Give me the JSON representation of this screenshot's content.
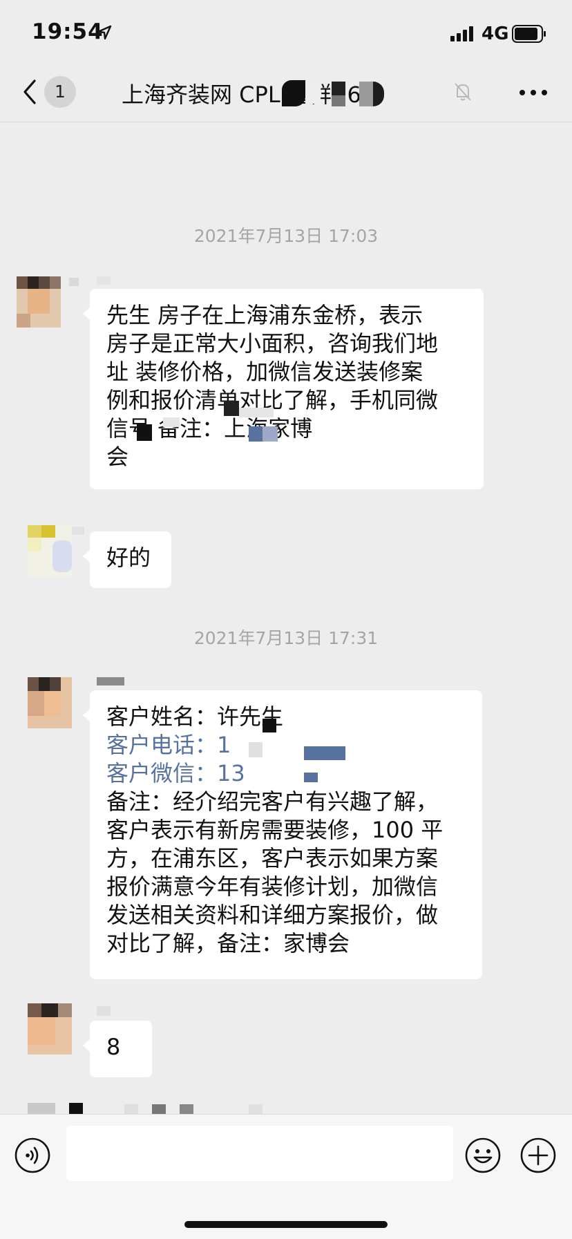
{
  "status_bar": {
    "time": "19:54",
    "network": "4G"
  },
  "nav": {
    "unread_count": "1",
    "title": "上海齐装网 CPL      通群 (6)"
  },
  "colors": {
    "background": "#ededed",
    "bubble": "#ffffff",
    "timestamp": "#a5a5a5",
    "link_blue": "#5872a0"
  },
  "messages": [
    {
      "type": "timestamp",
      "text": "2021年7月13日 17:03"
    },
    {
      "type": "text",
      "lines": [
        "先生 房子在上海浦东金桥，表示",
        "房子是正常大小面积，咨询我们地",
        "址 装修价格，加微信发送装修案",
        "例和报价清单对比了解，手机同微",
        "信号            备注：上海家博",
        "会"
      ]
    },
    {
      "type": "text",
      "lines": [
        "好的"
      ]
    },
    {
      "type": "timestamp",
      "text": "2021年7月13日 17:31"
    },
    {
      "type": "text",
      "lines": [
        "客户姓名：许先生",
        "客户电话：1",
        "客户微信：13",
        "备注：经介绍完客户有兴趣了解，",
        "客户表示有新房需要装修，100 平",
        "方，在浦东区，客户表示如果方案",
        "报价满意今年有装修计划，加微信",
        "发送相关资料和详细方案报价，做",
        "对比了解，备注：家博会"
      ]
    },
    {
      "type": "text",
      "lines": [
        "8"
      ]
    }
  ],
  "input": {
    "placeholder": ""
  },
  "icons": {
    "back": "chevron-left-icon",
    "mute": "bell-slash-icon",
    "more": "ellipsis-icon",
    "voice": "voice-icon",
    "emoji": "emoji-icon",
    "plus": "plus-icon"
  }
}
